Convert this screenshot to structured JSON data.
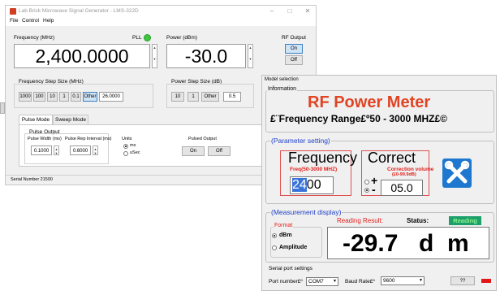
{
  "labbrick": {
    "title": "Lab Brick Microwave Signal Generator - LMS-322D",
    "controls": {
      "minimize": "–",
      "maximize": "□",
      "close": "✕"
    },
    "menu": [
      "File",
      "Control",
      "Help"
    ],
    "frequency_label": "Frequency (MHz)",
    "frequency_value": "2,400.0000",
    "pll_label": "PLL",
    "pll_status_color": "#3cc83c",
    "power_label": "Power (dBm)",
    "power_value": "-30.0",
    "rf_output_label": "RF Output",
    "rf_on": "On",
    "rf_off": "Off",
    "freq_step_label": "Frequency Step Size (MHz)",
    "freq_steps": [
      "1000",
      "100",
      "10",
      "1",
      "0.1",
      "Other"
    ],
    "freq_step_value": "26.0000",
    "power_step_label": "Power Step Size (dB)",
    "power_steps": [
      "10",
      "1",
      "Other"
    ],
    "power_step_value": "0.5",
    "tabs": [
      "Pulse Mode",
      "Sweep Mode"
    ],
    "pulse_output_group": "Pulse Output",
    "pulse_width_label": "Pulse Width (ms)",
    "pulse_width_value": "0.1000",
    "pulse_rep_label": "Pulse Rep Interval (ms)",
    "pulse_rep_value": "0.6000",
    "units_label": "Units",
    "unit_ms": "ms",
    "unit_usec": "uSec",
    "pulsed_output_label": "Pulsed Output",
    "pulsed_on": "On",
    "pulsed_off": "Off",
    "serial_number": "Serial Number 21500"
  },
  "meter": {
    "window_title": "Model selection",
    "info_label": "Information",
    "title": "RF Power Meter",
    "range": "£¨Frequency Range£º50 - 3000 MHZ£©",
    "param_legend": "(Parameter setting)",
    "frequency_label": "Frequency",
    "freq_hint": "Freq(50-3000 MHZ)",
    "frequency_selected": "24",
    "frequency_rest": "00",
    "correct_label": "Correct",
    "correction_hint": "Correction volume",
    "correction_hint2": "(£0-99.9dB)",
    "correct_plus": "+",
    "correct_minus": "-",
    "correct_value": "05.0",
    "measure_legend": "(Measurement display)",
    "format_label": "Format",
    "format_dbm": "dBm",
    "format_amplitude": "Amplitude",
    "reading_result_label": "Reading Result:",
    "status_label": "Status:",
    "status_value": "Reading",
    "reading_value": "-29.7",
    "reading_unit": "d  m",
    "serial_settings_label": "Serial port settings",
    "port_label": "Port number£º",
    "port_value": "COM7",
    "baud_label": "Baud Rate£º",
    "baud_value": "9600",
    "help_button": "??",
    "accent_red": "#e04424",
    "status_bg": "#1ca06a",
    "status_fg": "#8cf08c"
  }
}
